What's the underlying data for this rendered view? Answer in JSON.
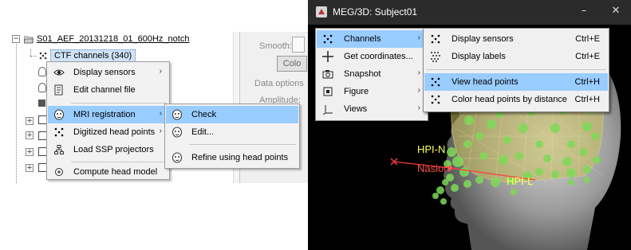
{
  "left_panel": {
    "tree": {
      "subject_node": "S01_AEF_20131218_01_600Hz_notch",
      "selected_node": "CTF channels (340)"
    },
    "side_panel": {
      "smooth_label": "Smooth:",
      "colormap_button": "Colo",
      "data_options_label": "Data options",
      "amplitude_label": "Amplitude:"
    },
    "context_menu": {
      "items": [
        {
          "label": "Display sensors",
          "icon": "eye-icon",
          "submenu": true
        },
        {
          "label": "Edit channel file",
          "icon": "edit-file-icon",
          "submenu": false
        },
        {
          "label": "MRI registration",
          "icon": "head-icon",
          "submenu": true,
          "highlighted": true
        },
        {
          "label": "Digitized head points",
          "icon": "dots-icon",
          "submenu": true
        },
        {
          "label": "Load SSP projectors",
          "icon": "tree-icon",
          "submenu": false
        },
        {
          "label": "Compute head model",
          "icon": "model-icon",
          "submenu": false
        }
      ]
    },
    "mri_submenu": {
      "items": [
        {
          "label": "Check",
          "icon": "head-icon",
          "highlighted": true
        },
        {
          "label": "Edit...",
          "icon": "head-icon"
        },
        {
          "label": "Refine using head points",
          "icon": "head-icon"
        }
      ]
    }
  },
  "right_panel": {
    "window_title": "MEG/3D: Subject01",
    "figure_menu": {
      "items": [
        {
          "label": "Channels",
          "icon": "dots-icon",
          "submenu": true,
          "highlighted": true
        },
        {
          "label": "Get coordinates...",
          "icon": "crosshair-icon",
          "submenu": false
        },
        {
          "label": "Snapshot",
          "icon": "camera-icon",
          "submenu": true
        },
        {
          "label": "Figure",
          "icon": "figure-icon",
          "submenu": true
        },
        {
          "label": "Views",
          "icon": "axes-icon",
          "submenu": true
        }
      ]
    },
    "channels_submenu": {
      "items": [
        {
          "label": "Display sensors",
          "shortcut": "Ctrl+E",
          "icon": "dots-icon"
        },
        {
          "label": "Display labels",
          "shortcut": "Ctrl+E",
          "icon": "labels-icon"
        },
        {
          "label": "View head points",
          "shortcut": "Ctrl+H",
          "icon": "dots-icon",
          "highlighted": true
        },
        {
          "label": "Color head points by distance",
          "shortcut": "Ctrl+H",
          "icon": "dots-icon"
        }
      ]
    },
    "scene_labels": {
      "hpi_n": "HPI-N",
      "nasion": "Nasion",
      "hpi_l": "HPI-L"
    },
    "colors": {
      "menu_highlight": "#99ccff",
      "titlebar": "#2b2b2b",
      "head_points": "#7ed957",
      "fiducial": "#ff3b3b",
      "hpi_label": "#ffff66"
    }
  }
}
